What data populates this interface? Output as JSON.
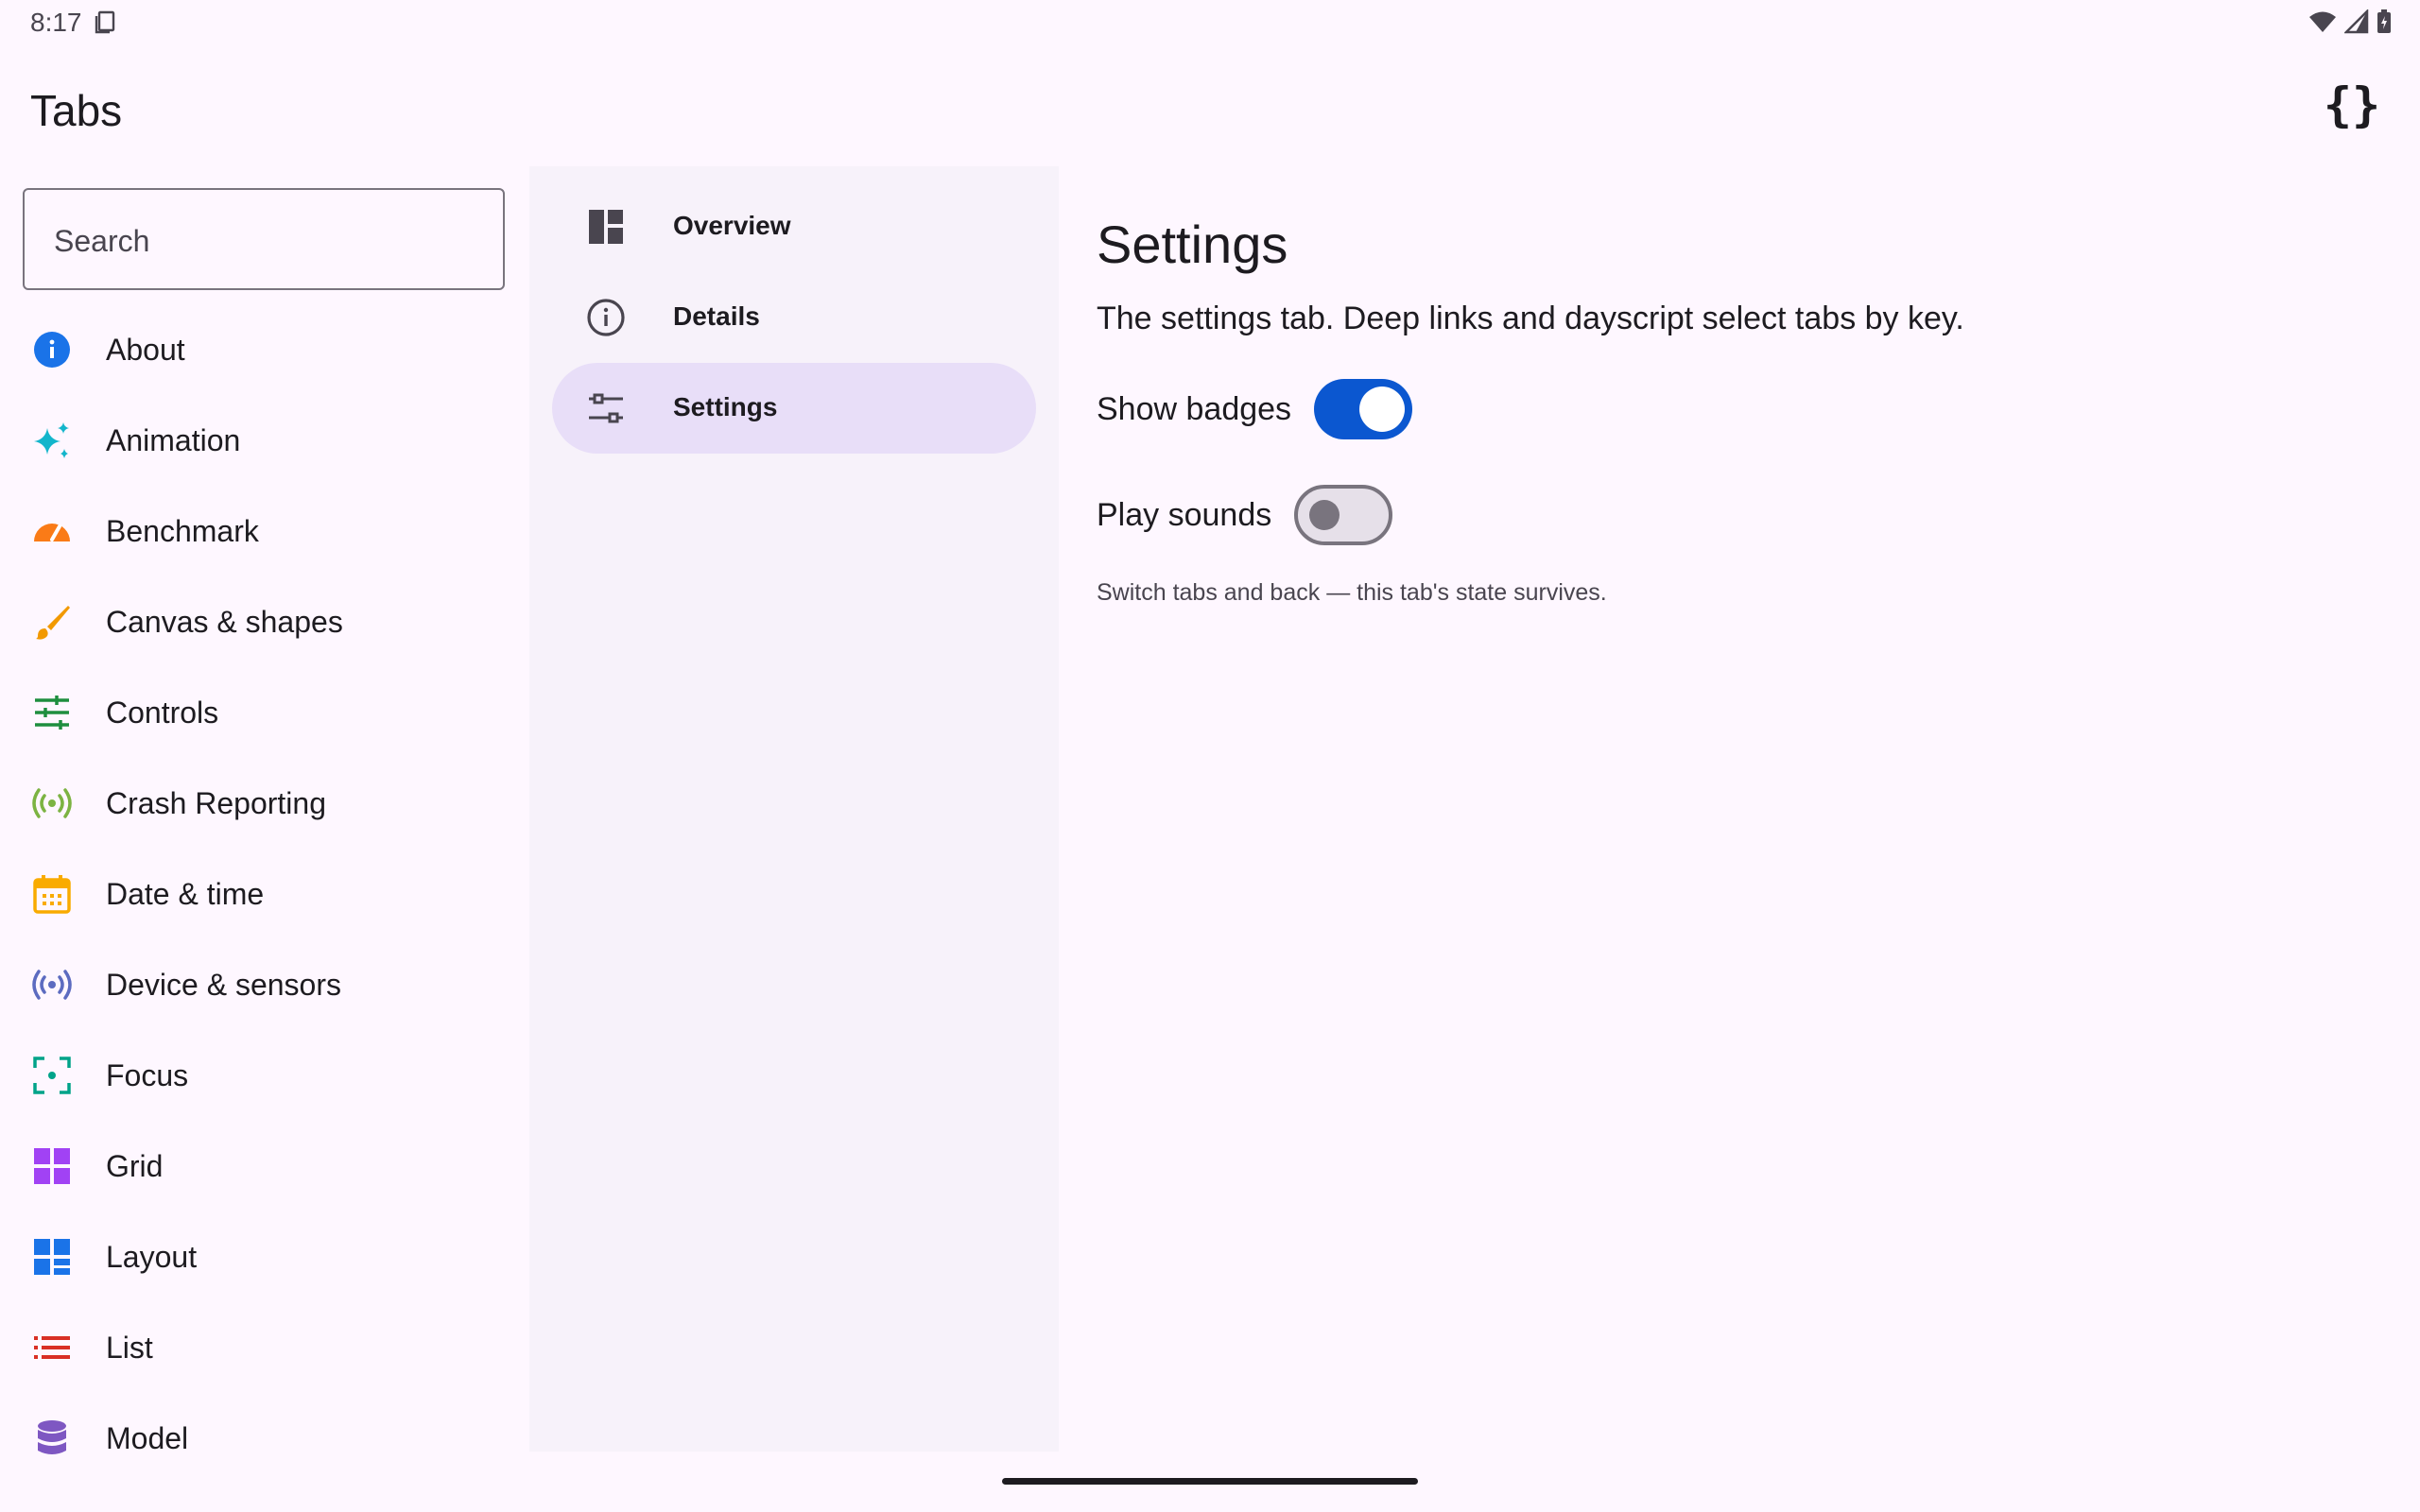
{
  "status_bar": {
    "time": "8:17"
  },
  "app_bar": {
    "title": "Tabs",
    "code_icon": "code-braces-icon"
  },
  "search": {
    "placeholder": "Search",
    "value": ""
  },
  "sidebar": {
    "items": [
      {
        "label": "About",
        "icon": "info-icon",
        "color": "#1a73e8"
      },
      {
        "label": "Animation",
        "icon": "sparkle-icon",
        "color": "#12b5cb"
      },
      {
        "label": "Benchmark",
        "icon": "speedometer-icon",
        "color": "#fa7b17"
      },
      {
        "label": "Canvas & shapes",
        "icon": "brush-icon",
        "color": "#f29900"
      },
      {
        "label": "Controls",
        "icon": "sliders-icon",
        "color": "#1e8e3e"
      },
      {
        "label": "Crash Reporting",
        "icon": "broadcast-icon",
        "color": "#7cb342"
      },
      {
        "label": "Date & time",
        "icon": "calendar-icon",
        "color": "#f9ab00"
      },
      {
        "label": "Device & sensors",
        "icon": "sensors-icon",
        "color": "#5c6bc0"
      },
      {
        "label": "Focus",
        "icon": "focus-icon",
        "color": "#00a389"
      },
      {
        "label": "Grid",
        "icon": "grid-icon",
        "color": "#a142f4"
      },
      {
        "label": "Layout",
        "icon": "layout-icon",
        "color": "#1a73e8"
      },
      {
        "label": "List",
        "icon": "list-icon",
        "color": "#d93025"
      },
      {
        "label": "Model",
        "icon": "database-icon",
        "color": "#7e57c2"
      }
    ]
  },
  "tabs": {
    "items": [
      {
        "label": "Overview",
        "icon": "dashboard-icon",
        "selected": false
      },
      {
        "label": "Details",
        "icon": "info-outline-icon",
        "selected": false
      },
      {
        "label": "Settings",
        "icon": "settings-sliders-icon",
        "selected": true
      }
    ]
  },
  "content": {
    "title": "Settings",
    "description": "The settings tab. Deep links and dayscript select tabs by key.",
    "toggles": [
      {
        "label": "Show badges",
        "on": true
      },
      {
        "label": "Play sounds",
        "on": false
      }
    ],
    "hint": "Switch tabs and back — this tab's state survives."
  },
  "colors": {
    "accent": "#0b57d0",
    "tab_selected": "#e8def8",
    "background": "#fef7ff",
    "pane": "#f7f2fa"
  }
}
